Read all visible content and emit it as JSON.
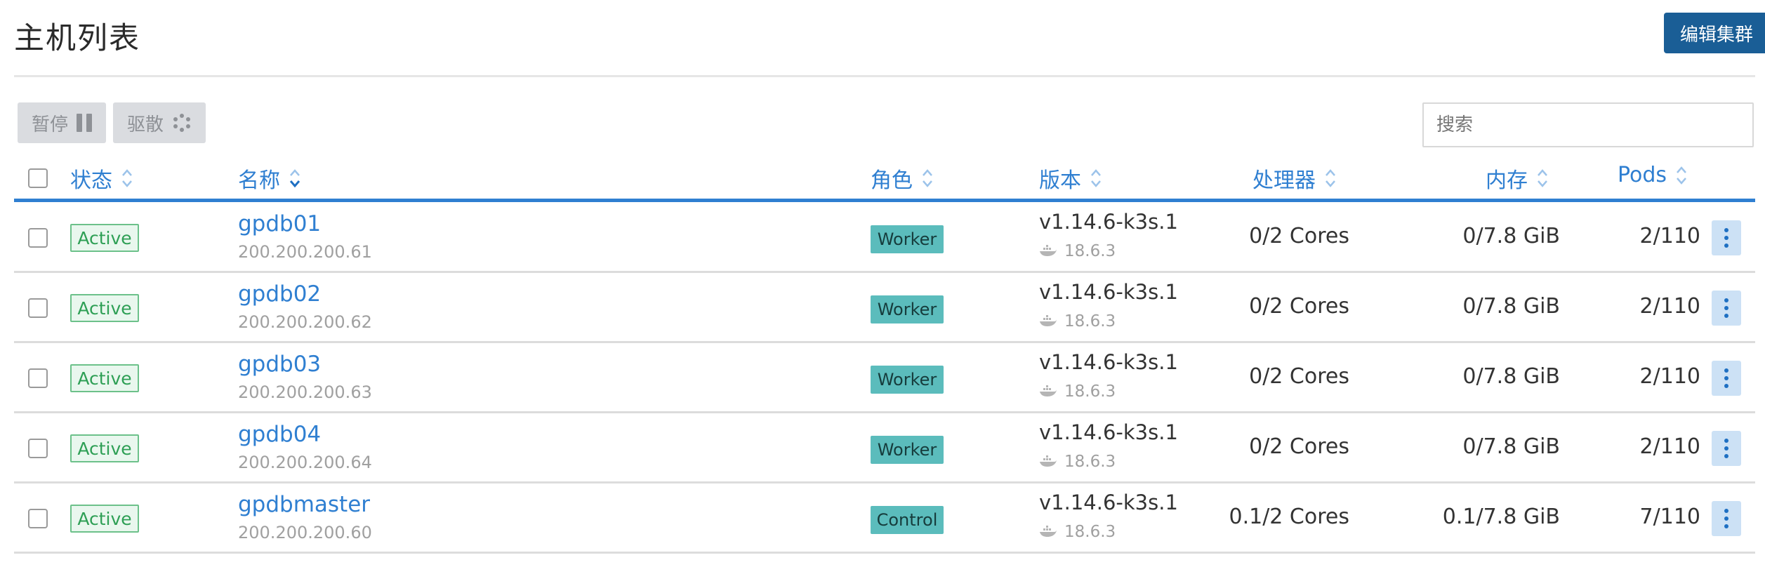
{
  "header": {
    "title": "主机列表",
    "edit_cluster_label": "编辑集群"
  },
  "toolbar": {
    "pause_label": "暂停",
    "drain_label": "驱散"
  },
  "search": {
    "placeholder": "搜索"
  },
  "columns": {
    "state": "状态",
    "name": "名称",
    "roles": "角色",
    "version": "版本",
    "cpu": "处理器",
    "memory": "内存",
    "pods": "Pods"
  },
  "rows": [
    {
      "status": "Active",
      "name": "gpdb01",
      "ip": "200.200.200.61",
      "role": "Worker",
      "version": "v1.14.6-k3s.1",
      "docker": "18.6.3",
      "cpu": "0/2 Cores",
      "memory": "0/7.8 GiB",
      "pods": "2/110"
    },
    {
      "status": "Active",
      "name": "gpdb02",
      "ip": "200.200.200.62",
      "role": "Worker",
      "version": "v1.14.6-k3s.1",
      "docker": "18.6.3",
      "cpu": "0/2 Cores",
      "memory": "0/7.8 GiB",
      "pods": "2/110"
    },
    {
      "status": "Active",
      "name": "gpdb03",
      "ip": "200.200.200.63",
      "role": "Worker",
      "version": "v1.14.6-k3s.1",
      "docker": "18.6.3",
      "cpu": "0/2 Cores",
      "memory": "0/7.8 GiB",
      "pods": "2/110"
    },
    {
      "status": "Active",
      "name": "gpdb04",
      "ip": "200.200.200.64",
      "role": "Worker",
      "version": "v1.14.6-k3s.1",
      "docker": "18.6.3",
      "cpu": "0/2 Cores",
      "memory": "0/7.8 GiB",
      "pods": "2/110"
    },
    {
      "status": "Active",
      "name": "gpdbmaster",
      "ip": "200.200.200.60",
      "role": "Control",
      "version": "v1.14.6-k3s.1",
      "docker": "18.6.3",
      "cpu": "0.1/2 Cores",
      "memory": "0.1/7.8 GiB",
      "pods": "7/110"
    }
  ],
  "colors": {
    "accent": "#2f7fd1",
    "primary_button": "#1a5e96",
    "active_green": "#2e9f55",
    "role_teal": "#5bbcbc"
  }
}
